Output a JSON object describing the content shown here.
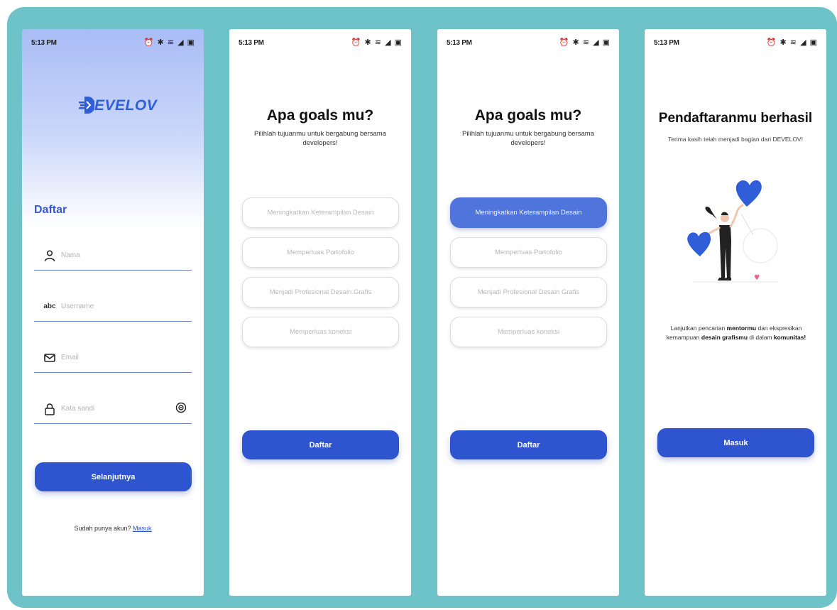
{
  "status_bar": {
    "time": "5:13 PM",
    "icons": "⏰ ✱ ≋ ◢ ▣"
  },
  "screen1": {
    "logo_text": "EVELOV",
    "title": "Daftar",
    "fields": [
      {
        "icon": "user-icon",
        "placeholder": "Nama"
      },
      {
        "icon": "abc-icon",
        "placeholder": "Username"
      },
      {
        "icon": "mail-icon",
        "placeholder": "Email"
      },
      {
        "icon": "lock-icon",
        "placeholder": "Kata sandi"
      }
    ],
    "abc_glyph": "abc",
    "button_label": "Selanjutnya",
    "login_prompt": "Sudah punya akun?",
    "login_link": "Masuk"
  },
  "goals": {
    "title": "Apa goals mu?",
    "subtitle": "Pilihlah tujuanmu untuk bergabung bersama developers!",
    "options": [
      "Meningkatkan Keterampilan Desain",
      "Memperluas Portofolio",
      "Menjadi Profesional Desain Grafis",
      "Memperluas koneksi"
    ],
    "button_label": "Daftar"
  },
  "success": {
    "title": "Pendaftaranmu berhasil",
    "subtitle": "Terima kasih telah menjadi bagian dari DEVELOV!",
    "text_1": "Lanjutkan pencarian ",
    "text_bold_1": "mentormu",
    "text_2": " dan ekspresikan kemampuan ",
    "text_bold_2": "desain grafismu",
    "text_3": " di dalam ",
    "text_bold_3": "komunitas!",
    "button_label": "Masuk"
  },
  "colors": {
    "primary": "#2e54d0",
    "selected": "#4f74dc",
    "frame": "#6dc3c8",
    "heart": "#2f5ed8"
  }
}
